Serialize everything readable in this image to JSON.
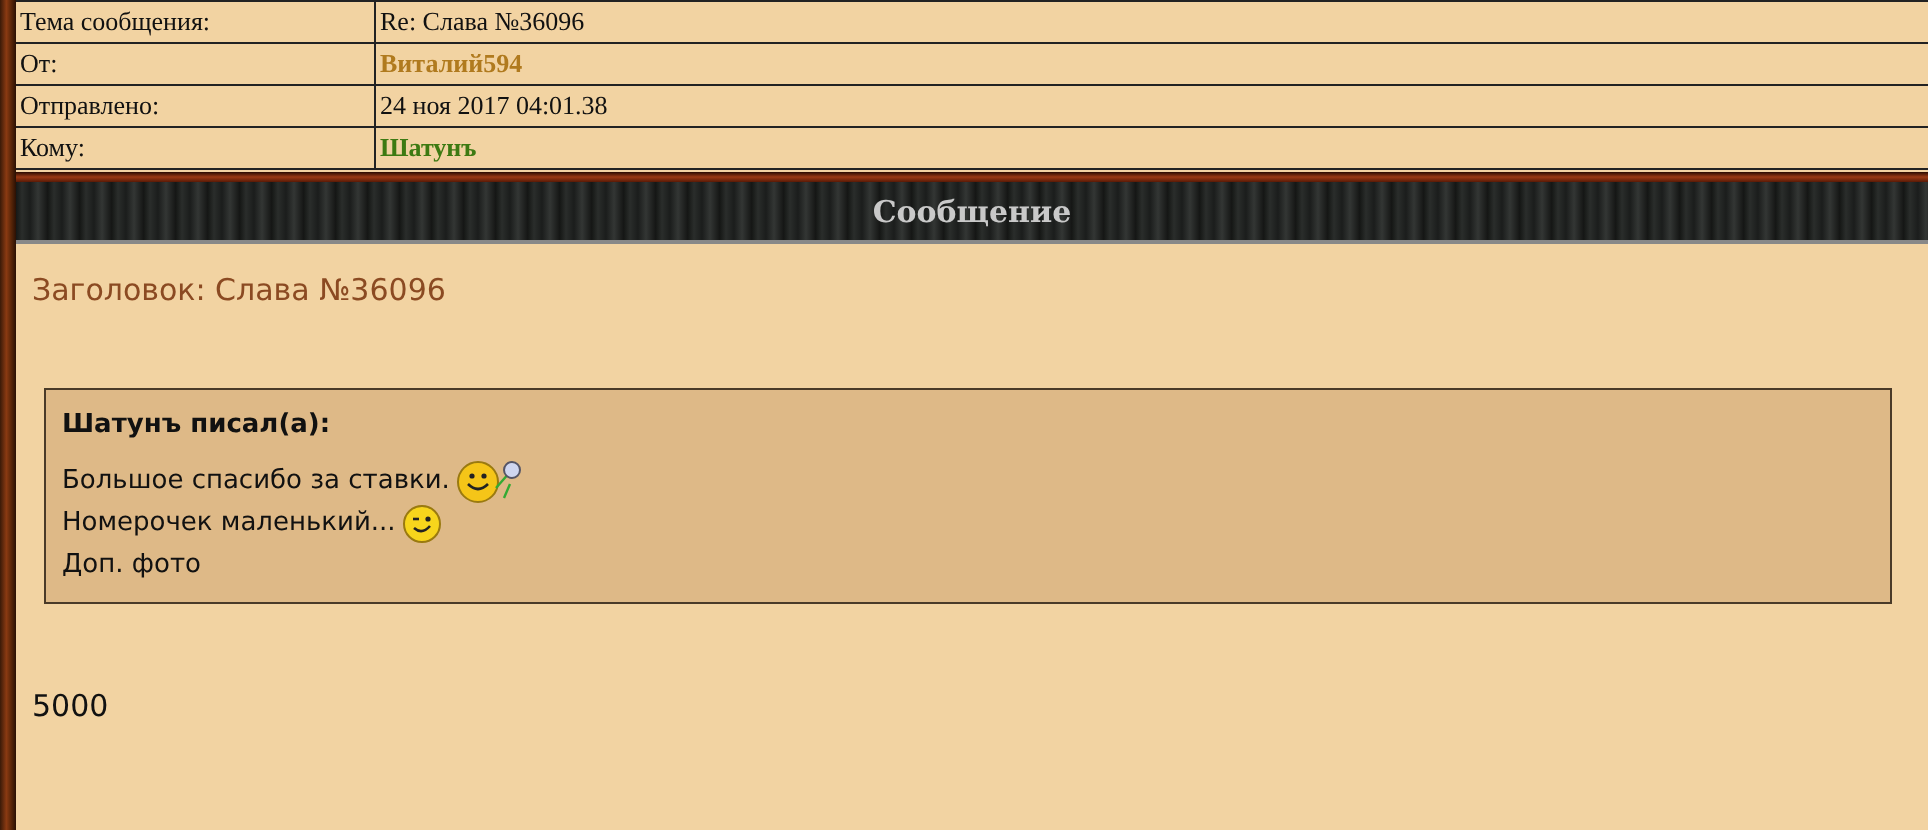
{
  "header_rows": [
    {
      "label": "Тема сообщения:",
      "value": "Re: Слава №36096",
      "kind": "plain"
    },
    {
      "label": "От:",
      "value": "Виталий594",
      "kind": "sender"
    },
    {
      "label": "Отправлено:",
      "value": "24 ноя 2017 04:01.38",
      "kind": "plain"
    },
    {
      "label": "Кому:",
      "value": "Шатунъ",
      "kind": "recipient"
    }
  ],
  "section_title": "Сообщение",
  "message": {
    "heading": "Заголовок: Слава №36096",
    "quote": {
      "author": "Шатунъ писал(а):",
      "lines": [
        {
          "text": "Большое спасибо за ставки.",
          "kind": "smile-flower"
        },
        {
          "text": "Номерочек маленький...",
          "kind": "wink"
        },
        {
          "text": "Доп. фото",
          "kind": "plain"
        }
      ]
    },
    "body": "5000"
  }
}
